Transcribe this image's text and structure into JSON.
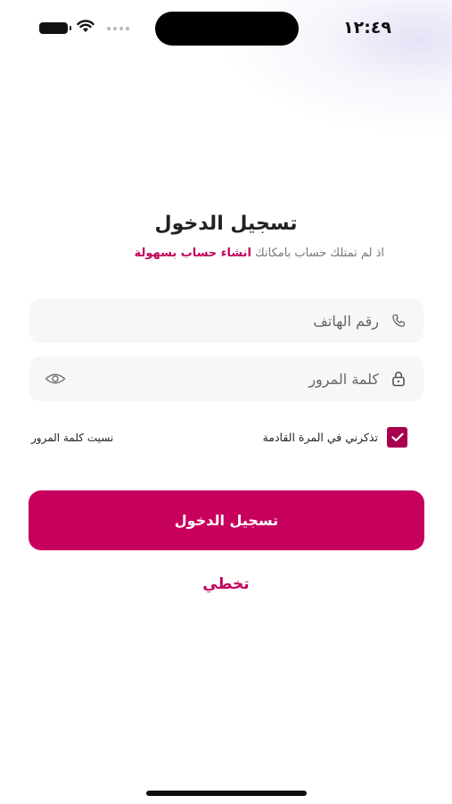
{
  "status_bar": {
    "time": "١٢:٤٩",
    "icons": [
      "battery-icon",
      "wifi-icon",
      "signal-dots-icon"
    ]
  },
  "login": {
    "title": "تسجيل الدخول",
    "subtitle_prefix": "اذ لم تمتلك حساب بامكانك",
    "subtitle_link": "انشاء حساب بسهولة",
    "phone_placeholder": "رقم الهاتف",
    "password_placeholder": "كلمة المرور",
    "remember_label": "تذكرني في المرة القادمة",
    "remember_checked": true,
    "forgot_label": "نسيت كلمة المرور",
    "submit_label": "تسجيل الدخول",
    "skip_label": "تخطي"
  },
  "colors": {
    "accent": "#c7005d",
    "link": "#c2005b",
    "checkbox": "#a8004f",
    "field_bg": "#f7f7f9"
  }
}
